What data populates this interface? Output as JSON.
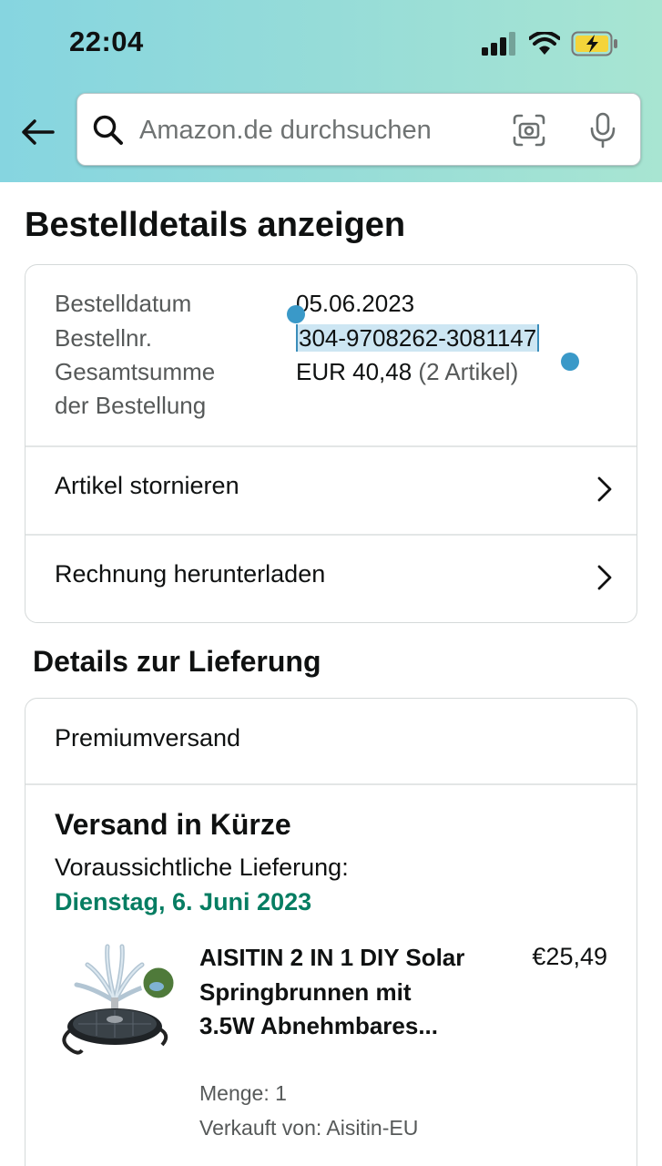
{
  "status_bar": {
    "time": "22:04"
  },
  "search": {
    "placeholder": "Amazon.de durchsuchen"
  },
  "page": {
    "title": "Bestelldetails anzeigen"
  },
  "order_summary": {
    "date_label": "Bestelldatum",
    "date_value": "05.06.2023",
    "number_label": "Bestellnr.",
    "number_value": "304-9708262-3081147",
    "total_label_line1": "Gesamtsumme",
    "total_label_line2": "der Bestellung",
    "total_value": "EUR 40,48",
    "total_items": "(2 Artikel)"
  },
  "actions": {
    "cancel_label": "Artikel stornieren",
    "invoice_label": "Rechnung herunterladen"
  },
  "delivery": {
    "section_title": "Details zur Lieferung",
    "shipping_method": "Premiumversand",
    "status_heading": "Versand in Kürze",
    "expected_label": "Voraussichtliche Lieferung:",
    "expected_date": "Dienstag, 6. Juni 2023",
    "accent_color": "#067d62"
  },
  "product": {
    "title": "AISITIN 2 IN 1 DIY Solar Springbrunnen mit 3.5W Abnehmbares...",
    "price": "€25,49",
    "quantity": "Menge: 1",
    "seller": "Verkauft von: Aisitin-EU"
  }
}
